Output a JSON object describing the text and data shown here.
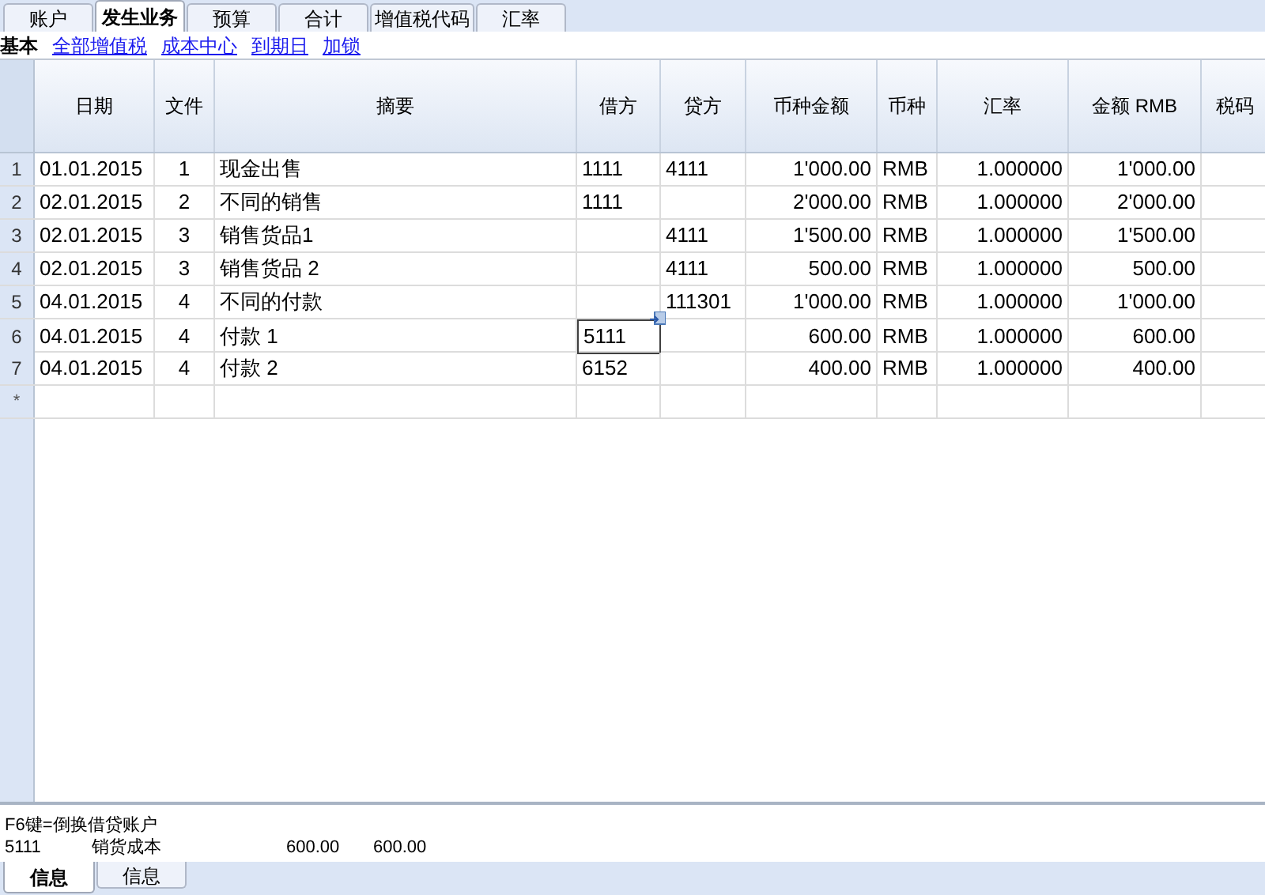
{
  "tabs": [
    {
      "label": "账户",
      "selected": false
    },
    {
      "label": "发生业务",
      "selected": true
    },
    {
      "label": "预算",
      "selected": false
    },
    {
      "label": "合计",
      "selected": false
    },
    {
      "label": "增值税代码",
      "selected": false
    },
    {
      "label": "汇率",
      "selected": false
    }
  ],
  "views": [
    {
      "label": "基本",
      "selected": true
    },
    {
      "label": "全部增值税",
      "selected": false
    },
    {
      "label": "成本中心",
      "selected": false
    },
    {
      "label": "到期日",
      "selected": false
    },
    {
      "label": "加锁",
      "selected": false
    }
  ],
  "table": {
    "columns": [
      "日期",
      "文件",
      "摘要",
      "借方",
      "贷方",
      "币种金额",
      "币种",
      "汇率",
      "金额 RMB",
      "税码"
    ],
    "rows": [
      {
        "number": "1",
        "date": "01.01.2015",
        "doc": "1",
        "description": "现金出售",
        "debit": "1111",
        "credit": "4111",
        "amount": "1'000.00",
        "currency": "RMB",
        "rate": "1.000000",
        "amount_rmb": "1'000.00",
        "debit_selected": false
      },
      {
        "number": "2",
        "date": "02.01.2015",
        "doc": "2",
        "description": "不同的销售",
        "debit": "1111",
        "amount": "2'000.00",
        "currency": "RMB",
        "rate": "1.000000",
        "amount_rmb": "2'000.00",
        "debit_selected": false
      },
      {
        "number": "3",
        "date": "02.01.2015",
        "doc": "3",
        "description": "销售货品1",
        "credit": "4111",
        "amount": "1'500.00",
        "currency": "RMB",
        "rate": "1.000000",
        "amount_rmb": "1'500.00",
        "debit_selected": false
      },
      {
        "number": "4",
        "date": "02.01.2015",
        "doc": "3",
        "description": "销售货品 2",
        "credit": "4111",
        "amount": "500.00",
        "currency": "RMB",
        "rate": "1.000000",
        "amount_rmb": "500.00",
        "debit_selected": false
      },
      {
        "number": "5",
        "date": "04.01.2015",
        "doc": "4",
        "description": "不同的付款",
        "credit": "111301",
        "amount": "1'000.00",
        "currency": "RMB",
        "rate": "1.000000",
        "amount_rmb": "1'000.00",
        "debit_selected": false
      },
      {
        "number": "6",
        "date": "04.01.2015",
        "doc": "4",
        "description": "付款 1",
        "debit": "5111",
        "amount": "600.00",
        "currency": "RMB",
        "rate": "1.000000",
        "amount_rmb": "600.00",
        "debit_selected": true
      },
      {
        "number": "7",
        "date": "04.01.2015",
        "doc": "4",
        "description": "付款 2",
        "debit": "6152",
        "amount": "400.00",
        "currency": "RMB",
        "rate": "1.000000",
        "amount_rmb": "400.00",
        "debit_selected": false
      }
    ],
    "new_row_marker": "*"
  },
  "info": {
    "hint": "F6键=倒换借贷账户",
    "account": "5111",
    "account_name": "销货成本",
    "amount_1": "600.00",
    "amount_2": "600.00"
  },
  "bottom_tabs": [
    {
      "label": "信息",
      "selected": true
    },
    {
      "label": "信息",
      "selected": false
    }
  ]
}
